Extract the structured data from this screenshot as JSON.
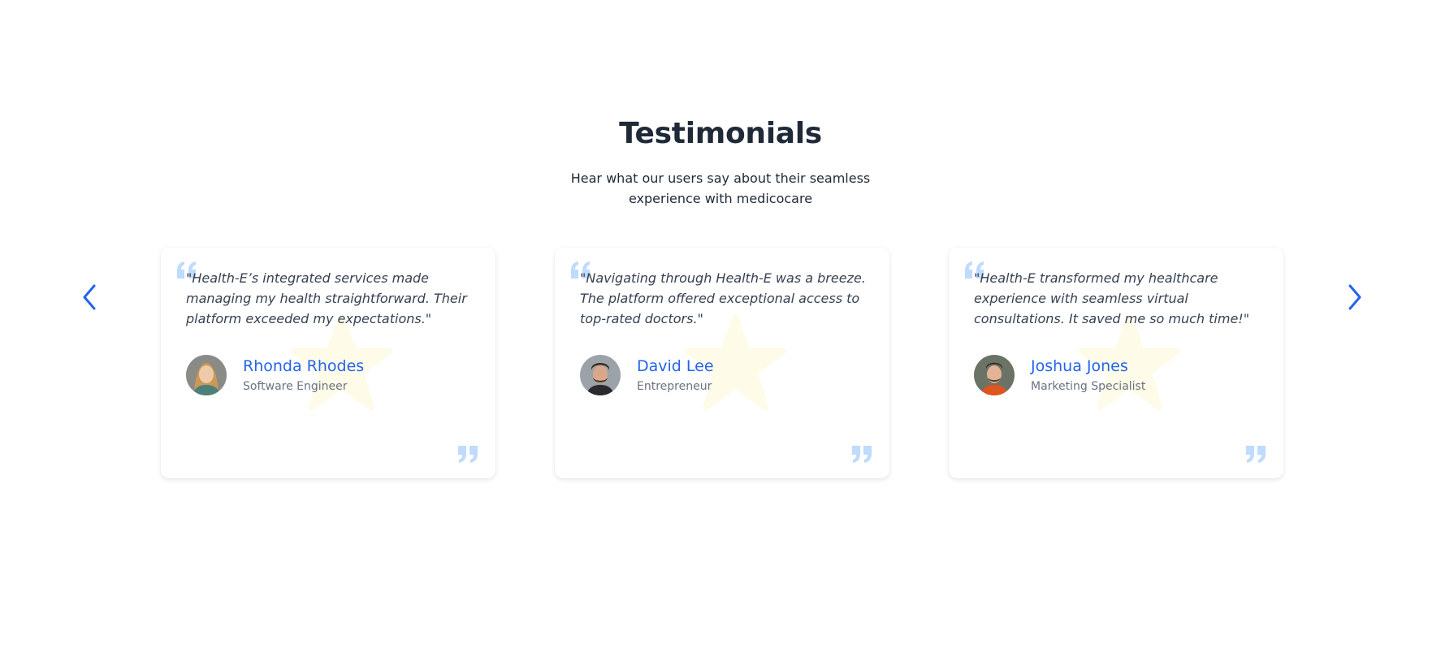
{
  "section": {
    "title": "Testimonials",
    "subtitle": "Hear what our users say about their seamless experience with medicocare"
  },
  "carousel": {
    "prev_icon": "chevron-left-icon",
    "next_icon": "chevron-right-icon"
  },
  "colors": {
    "accent": "#2563eb",
    "quote_mark": "#bfdbfe",
    "star": "#fefce8",
    "heading": "#1f2937",
    "muted": "#6b7280"
  },
  "testimonials": [
    {
      "quote": "\"Health-E’s integrated services made managing my health straightforward. Their platform exceeded my expectations.\"",
      "name": "Rhonda Rhodes",
      "role": "Software Engineer"
    },
    {
      "quote": "\"Navigating through Health-E was a breeze. The platform offered exceptional access to top-rated doctors.\"",
      "name": "David Lee",
      "role": "Entrepreneur"
    },
    {
      "quote": "\"Health-E transformed my healthcare experience with seamless virtual consultations. It saved me so much time!\"",
      "name": "Joshua Jones",
      "role": "Marketing Specialist"
    }
  ]
}
